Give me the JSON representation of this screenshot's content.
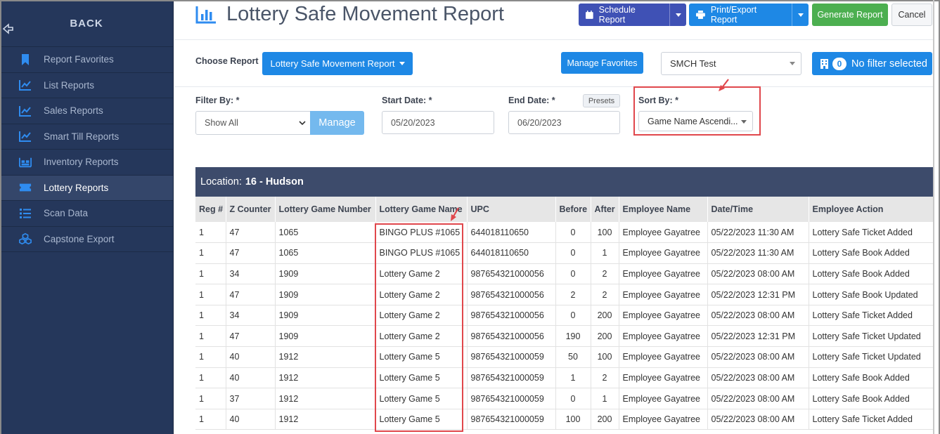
{
  "sidebar": {
    "back_label": "BACK",
    "items": [
      {
        "label": "Report Favorites",
        "icon": "bookmark-icon"
      },
      {
        "label": "List Reports",
        "icon": "chart-line-icon"
      },
      {
        "label": "Sales Reports",
        "icon": "chart-line-icon"
      },
      {
        "label": "Smart Till Reports",
        "icon": "chart-line-icon"
      },
      {
        "label": "Inventory Reports",
        "icon": "warehouse-icon"
      },
      {
        "label": "Lottery Reports",
        "icon": "ticket-icon"
      },
      {
        "label": "Scan Data",
        "icon": "list-icon"
      },
      {
        "label": "Capstone Export",
        "icon": "cubes-icon"
      }
    ],
    "active_index": 5
  },
  "header": {
    "title": "Lottery Safe Movement Report",
    "schedule_label": "Schedule Report",
    "print_label": "Print/Export Report",
    "generate_label": "Generate Report",
    "cancel_label": "Cancel"
  },
  "controls": {
    "choose_report_label": "Choose Report",
    "report_selected": "Lottery Safe Movement Report",
    "manage_favorites_label": "Manage Favorites",
    "store_selected": "SMCH Test",
    "filter_count": "0",
    "filter_label": "No filter selected"
  },
  "filters": {
    "filter_by_label": "Filter By: *",
    "filter_by_value": "Show All",
    "manage_label": "Manage",
    "start_date_label": "Start Date: *",
    "start_date_value": "05/20/2023",
    "end_date_label": "End Date: *",
    "end_date_value": "06/20/2023",
    "presets_label": "Presets",
    "sort_by_label": "Sort By: *",
    "sort_by_value": "Game Name Ascendi..."
  },
  "table": {
    "location_label": "Location:",
    "location_value": "16 - Hudson",
    "columns": [
      "Reg #",
      "Z Counter",
      "Lottery Game Number",
      "Lottery Game Name",
      "UPC",
      "Before",
      "After",
      "Employee Name",
      "Date/Time",
      "Employee Action"
    ],
    "rows": [
      [
        "1",
        "47",
        "1065",
        "BINGO PLUS #1065",
        "644018110650",
        "0",
        "100",
        "Employee Gayatree",
        "05/22/2023 11:30 AM",
        "Lottery Safe Ticket Added"
      ],
      [
        "1",
        "47",
        "1065",
        "BINGO PLUS #1065",
        "644018110650",
        "0",
        "1",
        "Employee Gayatree",
        "05/22/2023 11:30 AM",
        "Lottery Safe Book Added"
      ],
      [
        "1",
        "34",
        "1909",
        "Lottery Game 2",
        "987654321000056",
        "0",
        "2",
        "Employee Gayatree",
        "05/22/2023 08:00 AM",
        "Lottery Safe Book Added"
      ],
      [
        "1",
        "47",
        "1909",
        "Lottery Game 2",
        "987654321000056",
        "2",
        "2",
        "Employee Gayatree",
        "05/22/2023 12:31 PM",
        "Lottery Safe Book Updated"
      ],
      [
        "1",
        "34",
        "1909",
        "Lottery Game 2",
        "987654321000056",
        "0",
        "200",
        "Employee Gayatree",
        "05/22/2023 08:00 AM",
        "Lottery Safe Ticket Added"
      ],
      [
        "1",
        "47",
        "1909",
        "Lottery Game 2",
        "987654321000056",
        "190",
        "200",
        "Employee Gayatree",
        "05/22/2023 12:31 PM",
        "Lottery Safe Ticket Updated"
      ],
      [
        "1",
        "40",
        "1912",
        "Lottery Game 5",
        "987654321000059",
        "50",
        "100",
        "Employee Gayatree",
        "05/22/2023 08:00 AM",
        "Lottery Safe Ticket Updated"
      ],
      [
        "1",
        "40",
        "1912",
        "Lottery Game 5",
        "987654321000059",
        "1",
        "2",
        "Employee Gayatree",
        "05/22/2023 08:00 AM",
        "Lottery Safe Book Added"
      ],
      [
        "1",
        "37",
        "1912",
        "Lottery Game 5",
        "987654321000059",
        "0",
        "1",
        "Employee Gayatree",
        "05/22/2023 08:00 AM",
        "Lottery Safe Book Added"
      ],
      [
        "1",
        "40",
        "1912",
        "Lottery Game 5",
        "987654321000059",
        "100",
        "200",
        "Employee Gayatree",
        "05/22/2023 08:00 AM",
        "Lottery Safe Ticket Added"
      ]
    ]
  },
  "colors": {
    "sidebar_bg": "#25375b",
    "primary_blue": "#1e88e5",
    "schedule_indigo": "#3f51b5",
    "generate_green": "#4caf50",
    "annotation_red": "#e0474c",
    "location_bar": "#3d4b6b"
  }
}
